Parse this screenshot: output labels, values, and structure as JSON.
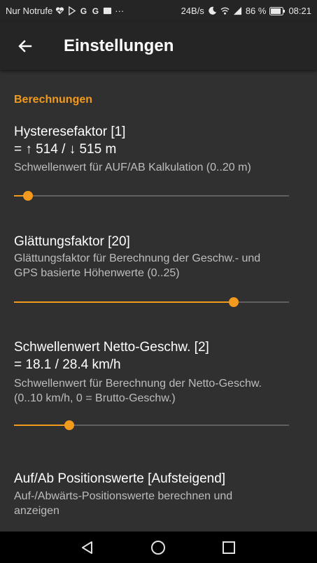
{
  "status_bar": {
    "carrier": "Nur Notrufe",
    "more": "···",
    "speed": "24B/s",
    "battery": "86 %",
    "time": "08:21"
  },
  "app_bar": {
    "title": "Einstellungen"
  },
  "section": {
    "header": "Berechnungen"
  },
  "settings": [
    {
      "title": "Hysteresefaktor [1]",
      "value_line": "= ↑ 514 / ↓ 515 m",
      "description": "Schwellenwert für AUF/AB Kalkulation (0..20 m)",
      "slider_fraction": 0.05
    },
    {
      "title": "Glättungsfaktor [20]",
      "description_line1": "Glättungsfaktor für Berechnung der Geschw.- und",
      "description_line2": "GPS basierte Höhenwerte (0..25)",
      "slider_fraction": 0.8
    },
    {
      "title": "Schwellenwert Netto-Geschw. [2]",
      "value_line": "= 18.1 / 28.4 km/h",
      "description_line1": "Schwellenwert für Berechnung der Netto-Geschw.",
      "description_line2": "(0..10 km/h, 0 = Brutto-Geschw.)",
      "slider_fraction": 0.2
    },
    {
      "title": "Auf/Ab Positionswerte [Aufsteigend]",
      "description_line1": "Auf-/Abwärts-Positionswerte berechnen und",
      "description_line2": "anzeigen"
    }
  ],
  "colors": {
    "accent": "#f29a1d",
    "background": "#303030",
    "bar": "#252525"
  }
}
